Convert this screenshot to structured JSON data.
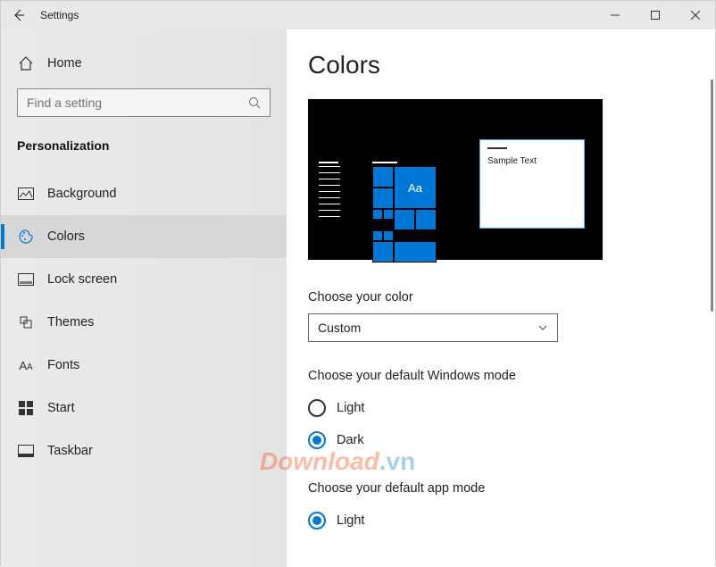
{
  "titlebar": {
    "label": "Settings"
  },
  "sidebar": {
    "home_label": "Home",
    "search_placeholder": "Find a setting",
    "category": "Personalization",
    "items": [
      {
        "label": "Background",
        "icon": "background-icon"
      },
      {
        "label": "Colors",
        "icon": "colors-icon"
      },
      {
        "label": "Lock screen",
        "icon": "lockscreen-icon"
      },
      {
        "label": "Themes",
        "icon": "themes-icon"
      },
      {
        "label": "Fonts",
        "icon": "fonts-icon"
      },
      {
        "label": "Start",
        "icon": "start-icon"
      },
      {
        "label": "Taskbar",
        "icon": "taskbar-icon"
      }
    ],
    "active_index": 1
  },
  "main": {
    "title": "Colors",
    "preview": {
      "sample_text": "Sample Text",
      "tile_letter": "Aa"
    },
    "choose_color": {
      "label": "Choose your color",
      "selected": "Custom"
    },
    "windows_mode": {
      "label": "Choose your default Windows mode",
      "options": [
        {
          "label": "Light",
          "checked": false
        },
        {
          "label": "Dark",
          "checked": true
        }
      ]
    },
    "app_mode": {
      "label": "Choose your default app mode",
      "options": [
        {
          "label": "Light",
          "checked": true
        }
      ]
    }
  },
  "watermark": "Download",
  "watermark_suffix": ".vn",
  "colors": {
    "accent": "#0078d7"
  }
}
